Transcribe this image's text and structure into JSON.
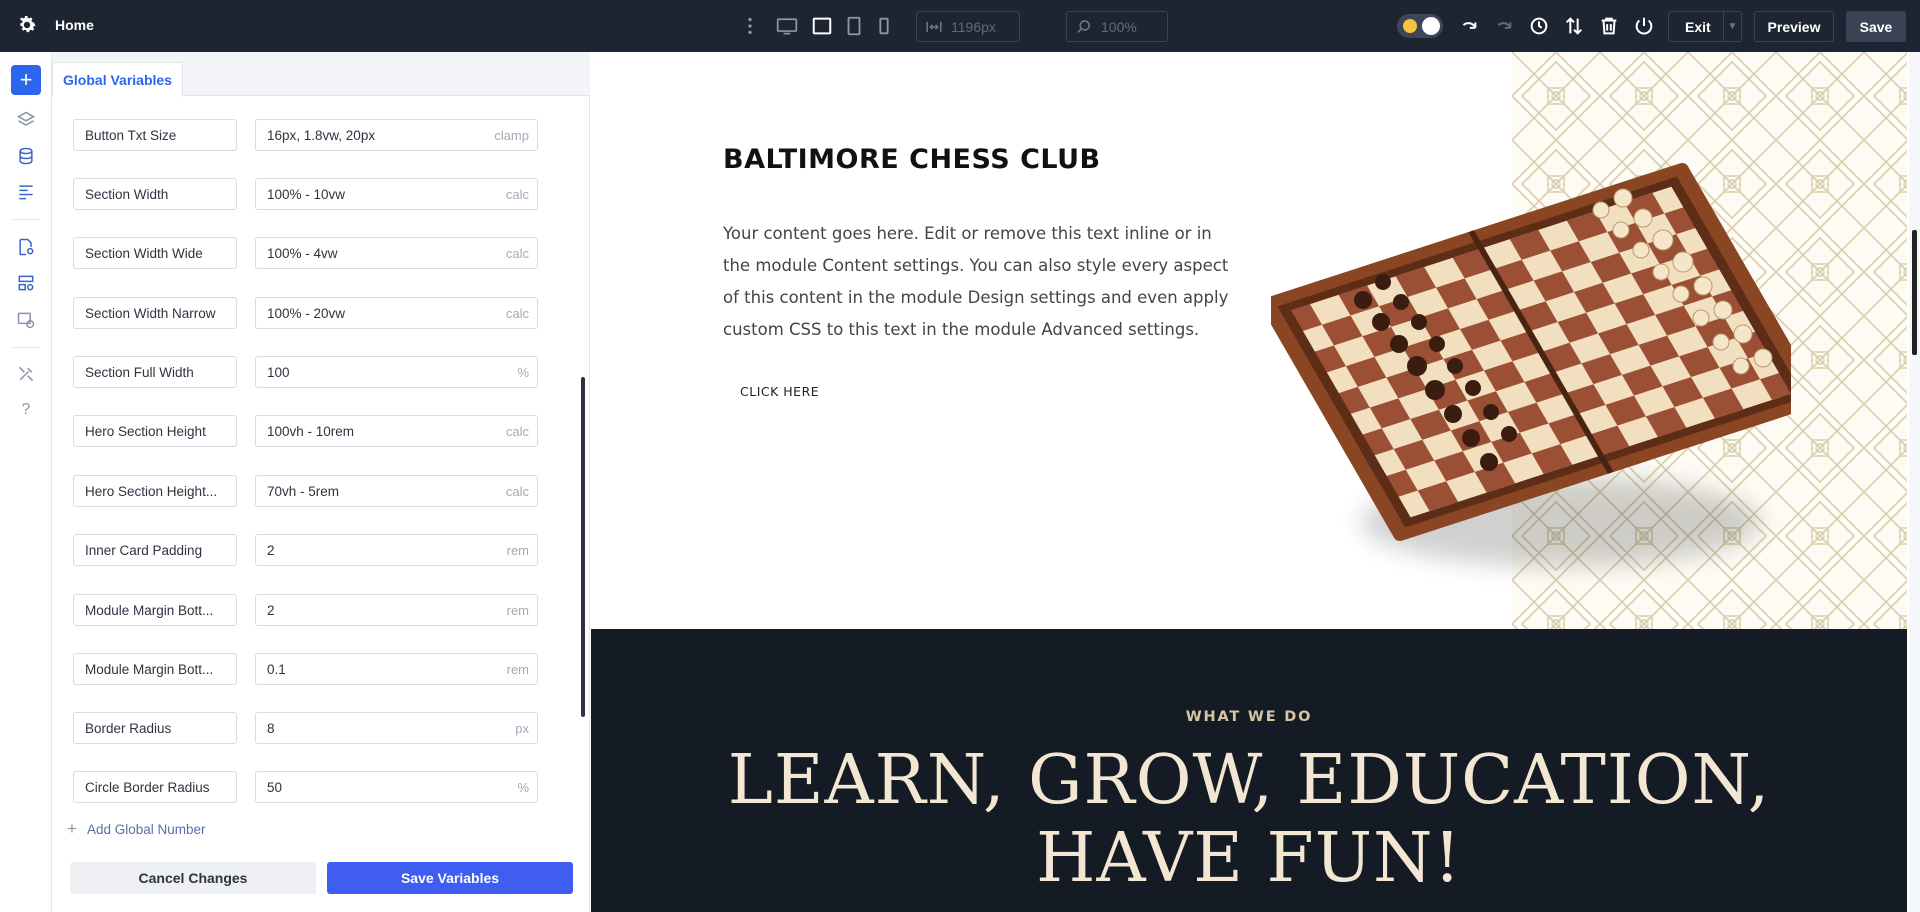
{
  "topbar": {
    "title": "Home",
    "width_value": "1196px",
    "zoom_value": "100%",
    "exit_label": "Exit",
    "preview_label": "Preview",
    "save_label": "Save",
    "icons": [
      "gear-icon",
      "kebab-icon",
      "desktop-icon",
      "tablet-landscape-icon",
      "tablet-portrait-icon",
      "phone-icon",
      "width-icon",
      "zoom-icon",
      "theme-toggle",
      "undo-icon",
      "redo-icon",
      "history-icon",
      "sort-icon",
      "trash-icon",
      "power-icon"
    ]
  },
  "rail": {
    "icons": [
      "add-icon",
      "layers-icon",
      "database-icon",
      "layout-icon",
      "page-settings-icon",
      "global-settings-icon",
      "theme-builder-icon",
      "tools-icon",
      "help-icon"
    ]
  },
  "panel": {
    "tab_label": "Global Variables",
    "rows": [
      {
        "name": "Button Txt Size",
        "value": "16px, 1.8vw, 20px",
        "unit": "clamp"
      },
      {
        "name": "Section Width",
        "value": "100% - 10vw",
        "unit": "calc"
      },
      {
        "name": "Section Width Wide",
        "value": "100% - 4vw",
        "unit": "calc"
      },
      {
        "name": "Section Width Narrow",
        "value": "100% - 20vw",
        "unit": "calc"
      },
      {
        "name": "Section Full Width",
        "value": "100",
        "unit": "%"
      },
      {
        "name": "Hero Section Height",
        "value": "100vh - 10rem",
        "unit": "calc"
      },
      {
        "name": "Hero Section Height...",
        "value": "70vh - 5rem",
        "unit": "calc"
      },
      {
        "name": "Inner Card Padding",
        "value": "2",
        "unit": "rem"
      },
      {
        "name": "Module Margin Bott...",
        "value": "2",
        "unit": "rem"
      },
      {
        "name": "Module Margin Bott...",
        "value": "0.1",
        "unit": "rem"
      },
      {
        "name": "Border Radius",
        "value": "8",
        "unit": "px"
      },
      {
        "name": "Circle Border Radius",
        "value": "50",
        "unit": "%"
      }
    ],
    "add_label": "Add Global Number",
    "cancel_label": "Cancel Changes",
    "save_label": "Save Variables"
  },
  "canvas": {
    "hero_title": "BALTIMORE CHESS CLUB",
    "hero_body": "Your content goes here. Edit or remove this text inline or in the module Content settings. You can also style every aspect of this content in the module Design settings and even apply custom CSS to this text in the module Advanced settings.",
    "hero_cta": "CLICK HERE",
    "eyebrow": "WHAT WE DO",
    "headline_line1": "LEARN, GROW, EDUCATION,",
    "headline_line2": "HAVE FUN!"
  },
  "colors": {
    "topbar_bg": "#1d2432",
    "accent": "#2c66ee",
    "save_variables": "#3f5df0",
    "dark_section": "#141b24",
    "headline": "#f3e6d3",
    "eyebrow": "#d8c5a4"
  }
}
